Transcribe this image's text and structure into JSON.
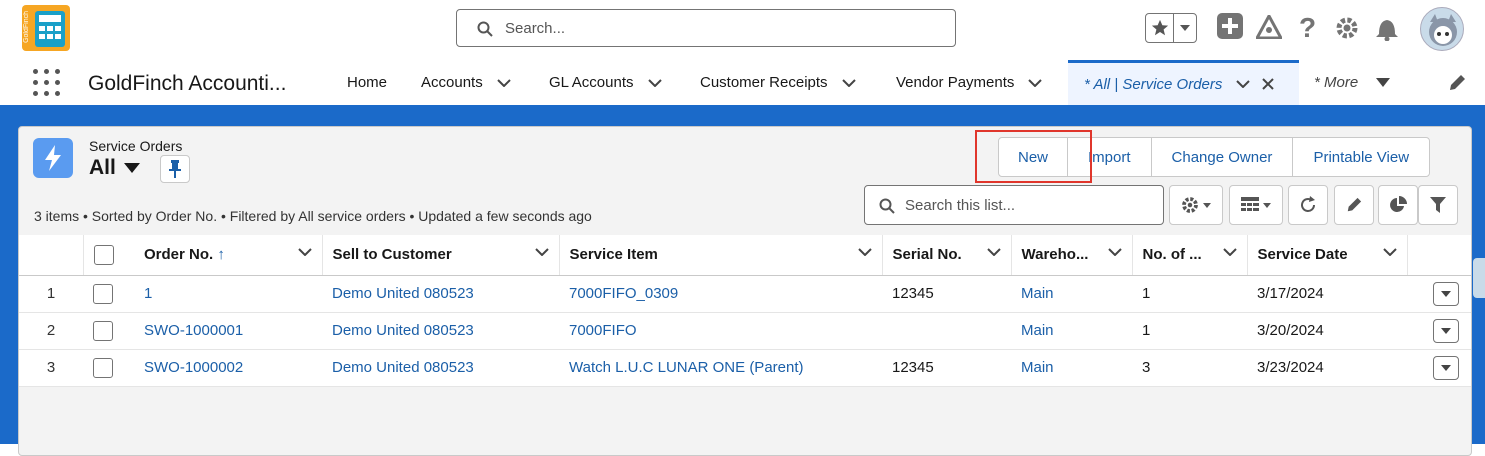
{
  "global": {
    "search_placeholder": "Search...",
    "logo_text": "GoldFinch"
  },
  "nav": {
    "app_name": "GoldFinch Accounti...",
    "tabs": [
      {
        "label": "Home"
      },
      {
        "label": "Accounts"
      },
      {
        "label": "GL Accounts"
      },
      {
        "label": "Customer Receipts"
      },
      {
        "label": "Vendor Payments"
      },
      {
        "label": "* All | Service Orders"
      },
      {
        "label": "* More"
      }
    ]
  },
  "list": {
    "object_label": "Service Orders",
    "view_name": "All",
    "status_text": "3 items • Sorted by Order No. • Filtered by All service orders • Updated a few seconds ago",
    "search_placeholder": "Search this list...",
    "buttons": {
      "new": "New",
      "import": "Import",
      "change_owner": "Change Owner",
      "printable_view": "Printable View"
    },
    "columns": [
      "Order No.",
      "Sell to Customer",
      "Service Item",
      "Serial No.",
      "Wareho...",
      "No. of ...",
      "Service Date"
    ],
    "sort_indicator": "↑",
    "rows": [
      {
        "num": "1",
        "order_no": "1",
        "customer": "Demo United 080523",
        "service_item": "7000FIFO_0309",
        "serial": "12345",
        "warehouse": "Main",
        "count": "1",
        "date": "3/17/2024"
      },
      {
        "num": "2",
        "order_no": "SWO-1000001",
        "customer": "Demo United 080523",
        "service_item": "7000FIFO",
        "serial": "",
        "warehouse": "Main",
        "count": "1",
        "date": "3/20/2024"
      },
      {
        "num": "3",
        "order_no": "SWO-1000002",
        "customer": "Demo United 080523",
        "service_item": "Watch L.U.C LUNAR ONE (Parent)",
        "serial": "12345",
        "warehouse": "Main",
        "count": "3",
        "date": "3/23/2024"
      }
    ]
  },
  "colors": {
    "brand": "#1b6ac9",
    "link": "#1b5fa8",
    "highlight": "#e0362c"
  }
}
